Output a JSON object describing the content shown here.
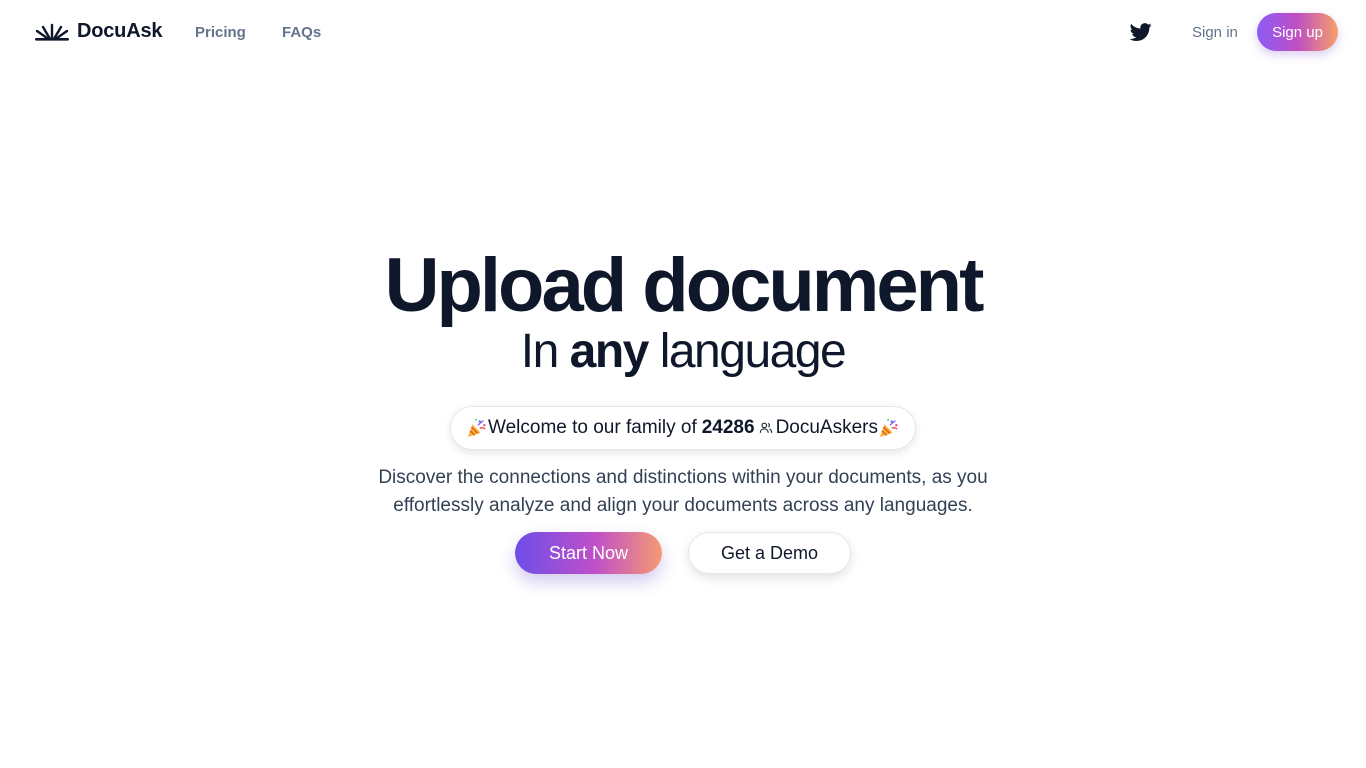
{
  "header": {
    "brand": "DocuAsk",
    "nav": {
      "pricing": "Pricing",
      "faqs": "FAQs"
    },
    "twitter_icon": "twitter-icon",
    "signin": "Sign in",
    "signup": "Sign up"
  },
  "hero": {
    "title": "Upload document",
    "subtitle_prefix": "In ",
    "subtitle_emphasis": "any",
    "subtitle_suffix": " language",
    "welcome": {
      "prefix": "Welcome to our family of",
      "count": "24286",
      "suffix": "DocuAskers",
      "icons": [
        "party-popper-icon",
        "users-icon",
        "party-popper-icon"
      ]
    },
    "description_line1": "Discover the connections and distinctions within your documents, as you",
    "description_line2": "effortlessly analyze and align your documents across any languages.",
    "cta_primary": "Start Now",
    "cta_secondary": "Get a Demo"
  },
  "colors": {
    "text": "#0f172a",
    "muted": "#64748b",
    "body_text": "#334155",
    "gradient_start": "#6d4ee8",
    "gradient_mid": "#c050c8",
    "gradient_end": "#f59a72"
  }
}
